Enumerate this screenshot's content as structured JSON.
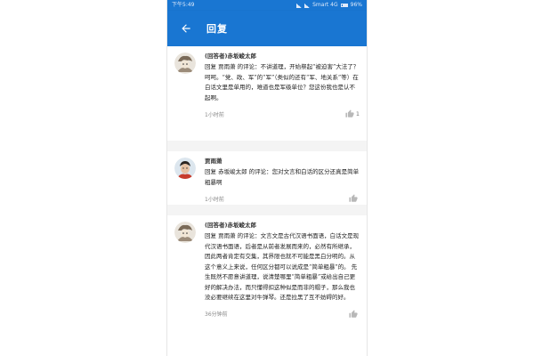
{
  "status": {
    "time": "下午5:49",
    "carrier": "Smart 4G",
    "battery": "96%"
  },
  "appbar": {
    "title": "回复"
  },
  "comments": [
    {
      "author": "(回答者)赤坂峻太郎",
      "text": "回复 贾雨萧 的评论：不讲道理，开始祭起“被迫害”大法了？呵呵。“党、政、军”的“军”（类似的还有“军、地关系”等）在白话文里是单用的，难道也是军级单位？您这份我也是认不起啊。",
      "time": "1小时前",
      "likes": "1"
    },
    {
      "author": "贾雨萧",
      "text": "回复 赤坂峻太郎 的评论：您对文言和白话的区分还真是简单粗暴啊",
      "time": "1小时前",
      "likes": ""
    },
    {
      "author": "(回答者)赤坂峻太郎",
      "text": "回复 贾雨萧 的评论：文言文是古代汉语书面语，白话文是现代汉语书面语，后者是从前者发展而来的，必然有所继承，因此两者肯定有交集，其界限也就不可能是黑白分明的。从这个意义上来说，任何区分都可以说成是“简单粗暴”的。 先生既然不愿意讲道理，说清楚哪里“简单粗暴”或给出自己更好的解决办法，而只懂得扣这种似是而非的帽子，那么我也没必要继续在这里对牛弹琴。还是拉黑了互不妨碍的好。",
      "time": "36分钟前",
      "likes": ""
    }
  ],
  "colors": {
    "primary": "#1976d2",
    "background": "#f4f4f4"
  },
  "icons": {
    "back": "arrow-left-icon",
    "like": "thumbs-up-icon"
  }
}
